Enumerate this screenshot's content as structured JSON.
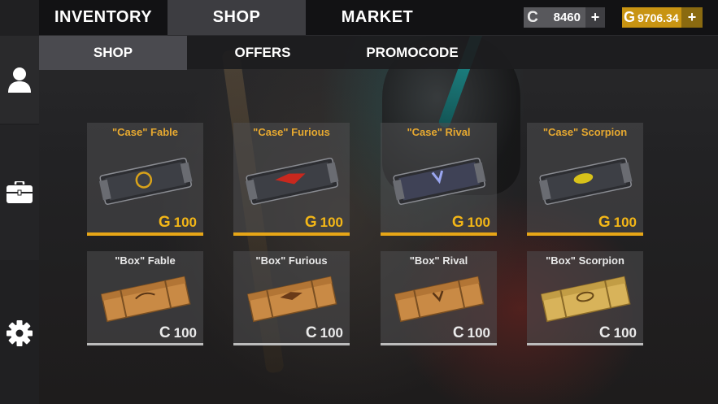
{
  "top_tabs": {
    "inventory": "INVENTORY",
    "shop": "SHOP",
    "market": "MARKET"
  },
  "currency": {
    "credits": {
      "symbol": "C",
      "value": "8460",
      "add": "+"
    },
    "gold": {
      "symbol": "G",
      "value": "9706.34",
      "add": "+"
    }
  },
  "sub_tabs": {
    "shop": "SHOP",
    "offers": "OFFERS",
    "promocode": "PROMOCODE"
  },
  "sidebar": {
    "icons": [
      "profile-icon",
      "briefcase-icon",
      "gear-icon"
    ]
  },
  "cases": [
    {
      "title": "\"Case\" Fable",
      "currency": "G",
      "price": "100",
      "color": "#d8a21a"
    },
    {
      "title": "\"Case\" Furious",
      "currency": "G",
      "price": "100",
      "color": "#c8281e"
    },
    {
      "title": "\"Case\" Rival",
      "currency": "G",
      "price": "100",
      "color": "#7e8ad8"
    },
    {
      "title": "\"Case\" Scorpion",
      "currency": "G",
      "price": "100",
      "color": "#d8c21a"
    }
  ],
  "boxes": [
    {
      "title": "\"Box\" Fable",
      "currency": "C",
      "price": "100",
      "wood": "#c98a45"
    },
    {
      "title": "\"Box\" Furious",
      "currency": "C",
      "price": "100",
      "wood": "#c98a45"
    },
    {
      "title": "\"Box\" Rival",
      "currency": "C",
      "price": "100",
      "wood": "#c98a45"
    },
    {
      "title": "\"Box\" Scorpion",
      "currency": "C",
      "price": "100",
      "wood": "#d8b35a"
    }
  ],
  "colors": {
    "gold_accent": "#e7a617",
    "active_tab": "#3d3d41",
    "topbar": "#121214"
  }
}
